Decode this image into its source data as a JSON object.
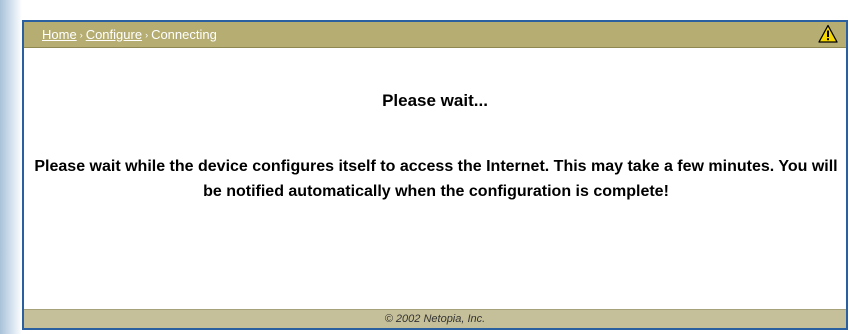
{
  "breadcrumb": {
    "home": "Home",
    "configure": "Configure",
    "current": "Connecting",
    "separator": "›"
  },
  "header": {
    "warning_icon": "warning-triangle-icon"
  },
  "main": {
    "title": "Please wait...",
    "message": "Please wait while the device configures itself to access the Internet. This may take a few minutes. You will be notified automatically when the configuration is complete!"
  },
  "footer": {
    "copyright": "© 2002 Netopia, Inc."
  },
  "colors": {
    "header_bar": "#b5ad72",
    "footer_bar": "#c6c09a",
    "frame_border": "#2a5fa0",
    "warning_fill": "#f5d800"
  }
}
